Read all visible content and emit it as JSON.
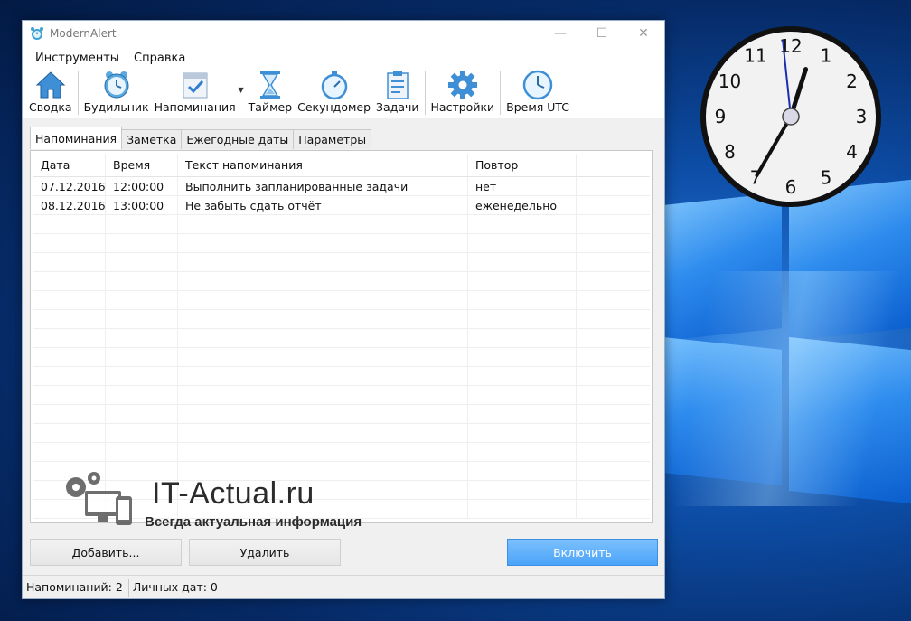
{
  "window": {
    "title": "ModernAlert",
    "controls": {
      "minimize": "—",
      "maximize": "☐",
      "close": "✕"
    }
  },
  "menu": [
    "Инструменты",
    "Справка"
  ],
  "toolbar": [
    {
      "label": "Сводка",
      "icon": "house-icon"
    },
    {
      "label": "Будильник",
      "icon": "alarm-clock-icon"
    },
    {
      "label": "Напоминания",
      "icon": "calendar-check-icon"
    },
    {
      "label": "Таймер",
      "icon": "hourglass-icon"
    },
    {
      "label": "Секундомер",
      "icon": "stopwatch-icon"
    },
    {
      "label": "Задачи",
      "icon": "clipboard-icon"
    },
    {
      "label": "Настройки",
      "icon": "gear-icon"
    },
    {
      "label": "Время UTC",
      "icon": "clock-icon"
    }
  ],
  "tabs": [
    "Напоминания",
    "Заметка",
    "Ежегодные даты",
    "Параметры"
  ],
  "active_tab": "Напоминания",
  "table": {
    "columns": [
      "Дата",
      "Время",
      "Текст напоминания",
      "Повтор",
      ""
    ],
    "rows": [
      [
        "07.12.2016",
        "12:00:00",
        "Выполнить запланированные задачи",
        "нет",
        ""
      ],
      [
        "08.12.2016",
        "13:00:00",
        "Не забыть сдать отчёт",
        "еженедельно",
        ""
      ]
    ]
  },
  "watermark": {
    "title": "IT-Actual.ru",
    "subtitle": "Всегда актуальная информация"
  },
  "buttons": {
    "add": "Добавить...",
    "delete": "Удалить",
    "enable": "Включить"
  },
  "status": {
    "reminders": "Напоминаний: 2",
    "personal_dates": "Личных дат: 0"
  },
  "clock": {
    "numerals": [
      "12",
      "1",
      "2",
      "3",
      "4",
      "5",
      "6",
      "7",
      "8",
      "9",
      "10",
      "11"
    ],
    "hour": 12,
    "minute": 35,
    "second": 59
  },
  "colors": {
    "accent": "#4aa4f8",
    "desktop": "#0d4ea8"
  }
}
